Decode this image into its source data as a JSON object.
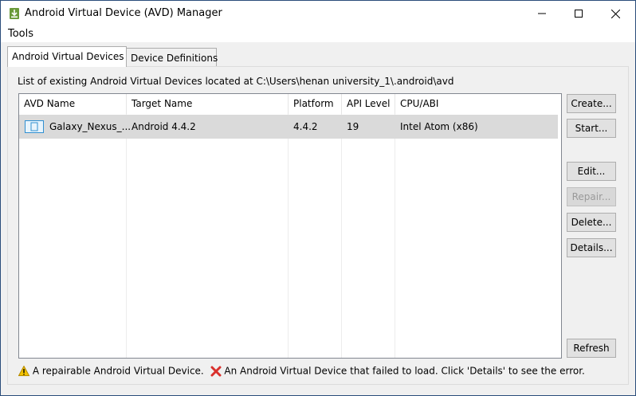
{
  "window": {
    "title": "Android Virtual Device (AVD) Manager"
  },
  "menu": {
    "tools": "Tools"
  },
  "tabs": [
    {
      "label": "Android Virtual Devices",
      "active": true
    },
    {
      "label": "Device Definitions",
      "active": false
    }
  ],
  "list_caption": "List of existing Android Virtual Devices located at C:\\Users\\henan university_1\\.android\\avd",
  "table": {
    "headers": [
      "AVD Name",
      "Target Name",
      "Platform",
      "API Level",
      "CPU/ABI"
    ],
    "rows": [
      {
        "avd_name": "Galaxy_Nexus_...",
        "target_name": "Android 4.4.2",
        "platform": "4.4.2",
        "api_level": "19",
        "cpu_abi": "Intel Atom (x86)"
      }
    ]
  },
  "buttons": {
    "create": "Create...",
    "start": "Start...",
    "edit": "Edit...",
    "repair": "Repair...",
    "delete": "Delete...",
    "details": "Details...",
    "refresh": "Refresh"
  },
  "legend": {
    "repairable": "A repairable Android Virtual Device.",
    "failed": "An Android Virtual Device that failed to load. Click 'Details' to see the error."
  },
  "colors": {
    "selected_row": "#dadada",
    "warning": "#e8b400",
    "error": "#d9302c"
  }
}
